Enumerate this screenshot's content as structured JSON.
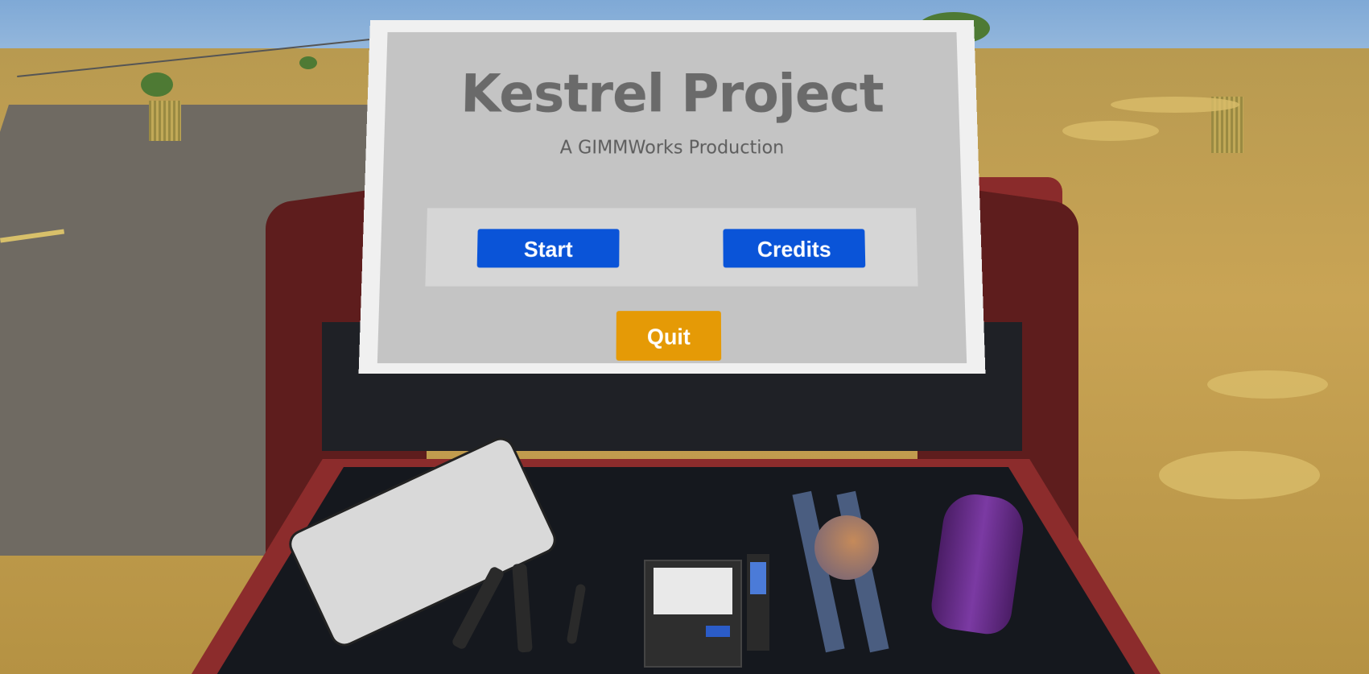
{
  "menu": {
    "title": "Kestrel Project",
    "subtitle": "A GIMMWorks Production",
    "buttons": {
      "start": "Start",
      "credits": "Credits",
      "quit": "Quit"
    }
  },
  "colors": {
    "button_blue": "#0a54d8",
    "button_orange": "#e59a06",
    "panel": "#c4c4c4",
    "title_text": "#6a6a6a"
  }
}
